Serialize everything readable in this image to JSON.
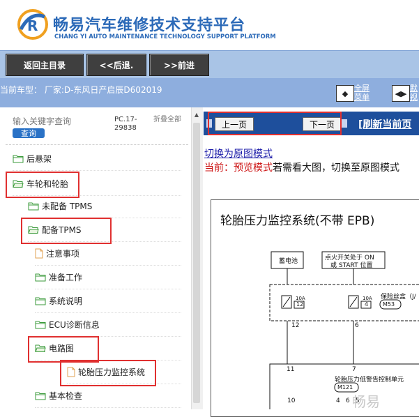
{
  "header": {
    "title": "畅易汽车维修技术支持平台",
    "subtitle": "CHANG YI AUTO MAINTENANCE TECHNOLOGY SUPPORT PLATFORM"
  },
  "toolbar": {
    "home_label": "返回主目录",
    "back_label": "<<后退.",
    "forward_label": ">>前进"
  },
  "vehicle": {
    "text": "当前车型： 厂家:D-东风日产启辰D602019",
    "fullscreen_label": "全屏菜单",
    "other_label": "默视"
  },
  "sidebar": {
    "search_placeholder": "输入关键字查询",
    "search_button": "查询",
    "pc_code": "PC.17-29838",
    "collapse_all": "折叠全部",
    "items": [
      {
        "label": "后悬架",
        "type": "folder"
      },
      {
        "label": "车轮和轮胎",
        "type": "folder-open"
      },
      {
        "label": "未配备 TPMS",
        "type": "folder"
      },
      {
        "label": "配备TPMS",
        "type": "folder-open"
      },
      {
        "label": "注意事项",
        "type": "doc"
      },
      {
        "label": "准备工作",
        "type": "folder"
      },
      {
        "label": "系统说明",
        "type": "folder"
      },
      {
        "label": "ECU诊断信息",
        "type": "folder"
      },
      {
        "label": "电路图",
        "type": "folder-open"
      },
      {
        "label": "轮胎压力监控系统",
        "type": "doc"
      },
      {
        "label": "基本检查",
        "type": "folder"
      }
    ]
  },
  "content": {
    "prev_page": "上一页",
    "next_page": "下一页",
    "refresh": "[刷新当前页",
    "switch_link": "切换为原图模式",
    "mode_current": "当前：预览模式",
    "mode_rest": "若需看大图，切换至原图模式",
    "diagram": {
      "title": "轮胎压力监控系统(不带 EPB)",
      "battery": "蓄电池",
      "ignition_line1": "点火开关处于 ON",
      "ignition_line2": "或 START 位置",
      "fuse_label": "保险丝盒（J/",
      "fuse1_amp": "10A",
      "fuse1_num": "12",
      "fuse2_amp": "10A",
      "fuse2_num": "4",
      "fuse_connector": "M53",
      "wire1": "12",
      "wire2": "6",
      "pin1": "11",
      "pin2": "7",
      "unit_label": "轮胎压力低警告控制单元",
      "unit_connector": "M121",
      "bottom_pins": [
        "10",
        "4",
        "6",
        "5"
      ]
    },
    "watermark": "畅易"
  },
  "colors": {
    "brand_blue": "#2c6ab8",
    "nav_bar": "#1e4f9c",
    "highlight_red": "#e03030",
    "mode_red": "#cc1010"
  }
}
